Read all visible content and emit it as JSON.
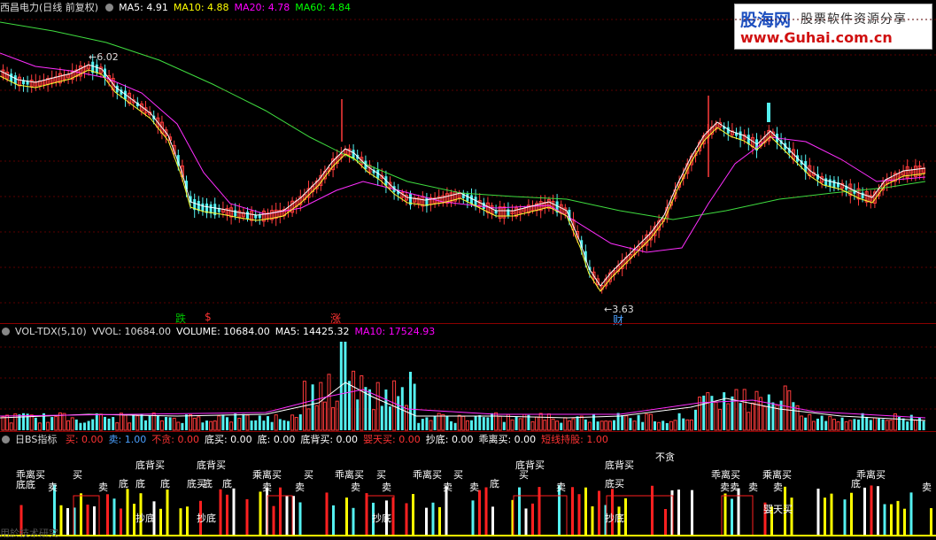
{
  "main_panel": {
    "title": "西昌电力",
    "mode": "(日线 前复权)",
    "ma5": {
      "label": "MA5:",
      "value": "4.91",
      "color": "#ffffff"
    },
    "ma10": {
      "label": "MA10:",
      "value": "4.88",
      "color": "#ffff00"
    },
    "ma20": {
      "label": "MA20:",
      "value": "4.78",
      "color": "#ff00ff"
    },
    "ma60": {
      "label": "MA60:",
      "value": "4.84",
      "color": "#00ff00"
    },
    "high_marker": "6.02",
    "low_marker": "3.63",
    "events": [
      {
        "text": "跌",
        "color": "#00c000"
      },
      {
        "text": "$",
        "color": "#ff3333"
      },
      {
        "text": "涨",
        "color": "#ff3333"
      },
      {
        "text": "财",
        "color": "#4aa0ff"
      }
    ]
  },
  "volume_panel": {
    "title": "VOL-TDX(5,10)",
    "vvol": "VVOL: 10684.00",
    "volume": "VOLUME: 10684.00",
    "ma5": "MA5: 14425.32",
    "ma10": "MA10: 17524.93"
  },
  "bs_panel": {
    "title": "日BS指标",
    "items": [
      {
        "label": "买:",
        "value": "0.00",
        "color": "#ff3333"
      },
      {
        "label": "卖:",
        "value": "1.00",
        "color": "#4aa0ff"
      },
      {
        "label": "不贪:",
        "value": "0.00",
        "color": "#ff3333"
      },
      {
        "label": "底买:",
        "value": "0.00",
        "color": "#ffffff"
      },
      {
        "label": "底:",
        "value": "0.00",
        "color": "#ffffff"
      },
      {
        "label": "底背买:",
        "value": "0.00",
        "color": "#ffffff"
      },
      {
        "label": "婴天买:",
        "value": "0.00",
        "color": "#ff3333"
      },
      {
        "label": "抄底:",
        "value": "0.00",
        "color": "#ffffff"
      },
      {
        "label": "乖离买:",
        "value": "0.00",
        "color": "#ffffff"
      },
      {
        "label": "短线持股:",
        "value": "1.00",
        "color": "#ff3333"
      }
    ],
    "signals": [
      {
        "text": "乖离买"
      },
      {
        "text": "买"
      },
      {
        "text": "底背买"
      },
      {
        "text": "底背买"
      },
      {
        "text": "底底"
      },
      {
        "text": "卖"
      },
      {
        "text": "卖"
      },
      {
        "text": "底"
      },
      {
        "text": "底"
      },
      {
        "text": "底"
      },
      {
        "text": "底买"
      },
      {
        "text": "底"
      },
      {
        "text": "底"
      },
      {
        "text": "抄底"
      },
      {
        "text": "抄底"
      },
      {
        "text": "乘离买"
      },
      {
        "text": "买"
      },
      {
        "text": "乖离买"
      },
      {
        "text": "买"
      },
      {
        "text": "乖离买"
      },
      {
        "text": "买"
      },
      {
        "text": "底背买"
      },
      {
        "text": "卖"
      },
      {
        "text": "卖"
      },
      {
        "text": "卖"
      },
      {
        "text": "卖"
      },
      {
        "text": "卖"
      },
      {
        "text": "卖"
      },
      {
        "text": "底"
      },
      {
        "text": "抄底"
      },
      {
        "text": "买"
      },
      {
        "text": "卖"
      },
      {
        "text": "底背买"
      },
      {
        "text": "底买"
      },
      {
        "text": "抄底"
      },
      {
        "text": "不贪"
      },
      {
        "text": "乖离买"
      },
      {
        "text": "乘离买"
      },
      {
        "text": "卖卖"
      },
      {
        "text": "卖"
      },
      {
        "text": "卖"
      },
      {
        "text": "婴天买"
      },
      {
        "text": "乖离买"
      },
      {
        "text": "底"
      },
      {
        "text": "卖"
      }
    ]
  },
  "watermark": {
    "brand": "股海网",
    "slogan": "股票软件资源分享",
    "url": "www.Guhai.com.cn"
  },
  "footer_text": "用於技术研究"
}
